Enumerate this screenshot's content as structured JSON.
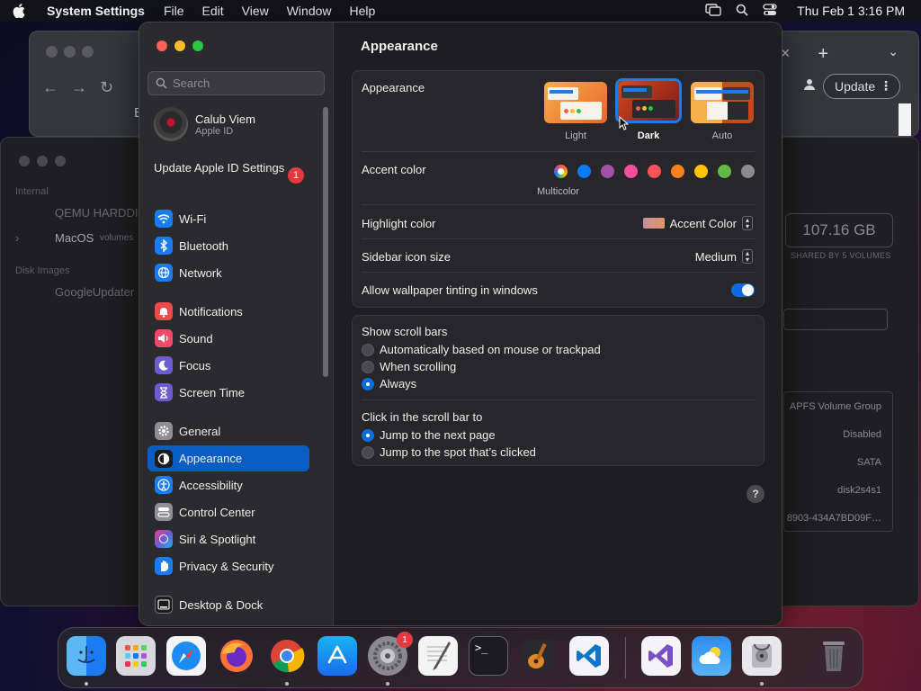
{
  "menubar": {
    "app_name": "System Settings",
    "menus": [
      "File",
      "Edit",
      "View",
      "Window",
      "Help"
    ],
    "clock": "Thu Feb 1  3:16 PM"
  },
  "chrome": {
    "update_label": "Update",
    "partial_tab_letter": "E"
  },
  "disk_utility": {
    "sections": [
      "Internal",
      "Disk Images"
    ],
    "items": [
      "QEMU HARDDI",
      "MacOS",
      "volumes",
      "GoogleUpdater"
    ],
    "capacity": "107.16 GB",
    "shared_note": "SHARED BY 5 VOLUMES",
    "info_rows": [
      "APFS Volume Group",
      "Disabled",
      "SATA",
      "disk2s4s1",
      "8903-434A7BD09F…"
    ]
  },
  "sidebar": {
    "search_placeholder": "Search",
    "account": {
      "name": "Calub Viem",
      "subtitle": "Apple ID"
    },
    "update_apple_id": "Update Apple ID Settings",
    "update_badge": "1",
    "items": [
      {
        "label": "Wi-Fi",
        "color": "#1a7cf0"
      },
      {
        "label": "Bluetooth",
        "color": "#1a7cf0"
      },
      {
        "label": "Network",
        "color": "#1a7cf0"
      },
      {
        "label": "Notifications",
        "color": "#ec4b4b"
      },
      {
        "label": "Sound",
        "color": "#ec4b6a"
      },
      {
        "label": "Focus",
        "color": "#6d5ccf"
      },
      {
        "label": "Screen Time",
        "color": "#6d5ccf"
      },
      {
        "label": "General",
        "color": "#8e8e93"
      },
      {
        "label": "Appearance",
        "color": "#1c1c1e"
      },
      {
        "label": "Accessibility",
        "color": "#1a7cf0"
      },
      {
        "label": "Control Center",
        "color": "#8e8e93"
      },
      {
        "label": "Siri & Spotlight",
        "color": "#b04ad8"
      },
      {
        "label": "Privacy & Security",
        "color": "#1a7cf0"
      },
      {
        "label": "Desktop & Dock",
        "color": "#1c1c1e"
      }
    ],
    "selected": "Appearance"
  },
  "main": {
    "title": "Appearance",
    "appearance_label": "Appearance",
    "themes": [
      "Light",
      "Dark",
      "Auto"
    ],
    "selected_theme": "Dark",
    "accent_label": "Accent color",
    "accent_colors": [
      "multicolor",
      "#0a7aff",
      "#a550a7",
      "#f74f9e",
      "#ff5257",
      "#f7821b",
      "#ffc600",
      "#62ba46",
      "#8c8c8c"
    ],
    "accent_selected_name": "Multicolor",
    "highlight_label": "Highlight color",
    "highlight_value": "Accent Color",
    "sidebar_icon_label": "Sidebar icon size",
    "sidebar_icon_value": "Medium",
    "tinting_label": "Allow wallpaper tinting in windows",
    "tinting_on": true,
    "scroll_bars_label": "Show scroll bars",
    "scroll_options": [
      "Automatically based on mouse or trackpad",
      "When scrolling",
      "Always"
    ],
    "scroll_selected": "Always",
    "click_label": "Click in the scroll bar to",
    "click_options": [
      "Jump to the next page",
      "Jump to the spot that’s clicked"
    ],
    "click_selected": "Jump to the next page",
    "help": "?"
  },
  "dock": {
    "apps": [
      "Finder",
      "Launchpad",
      "Safari",
      "Firefox",
      "Chrome",
      "App Store",
      "System Settings",
      "TextEdit",
      "Terminal",
      "GarageBand",
      "Visual Studio Code",
      "Visual Studio",
      "Weather",
      "Disk Utility",
      "Trash"
    ],
    "settings_badge": "1"
  }
}
